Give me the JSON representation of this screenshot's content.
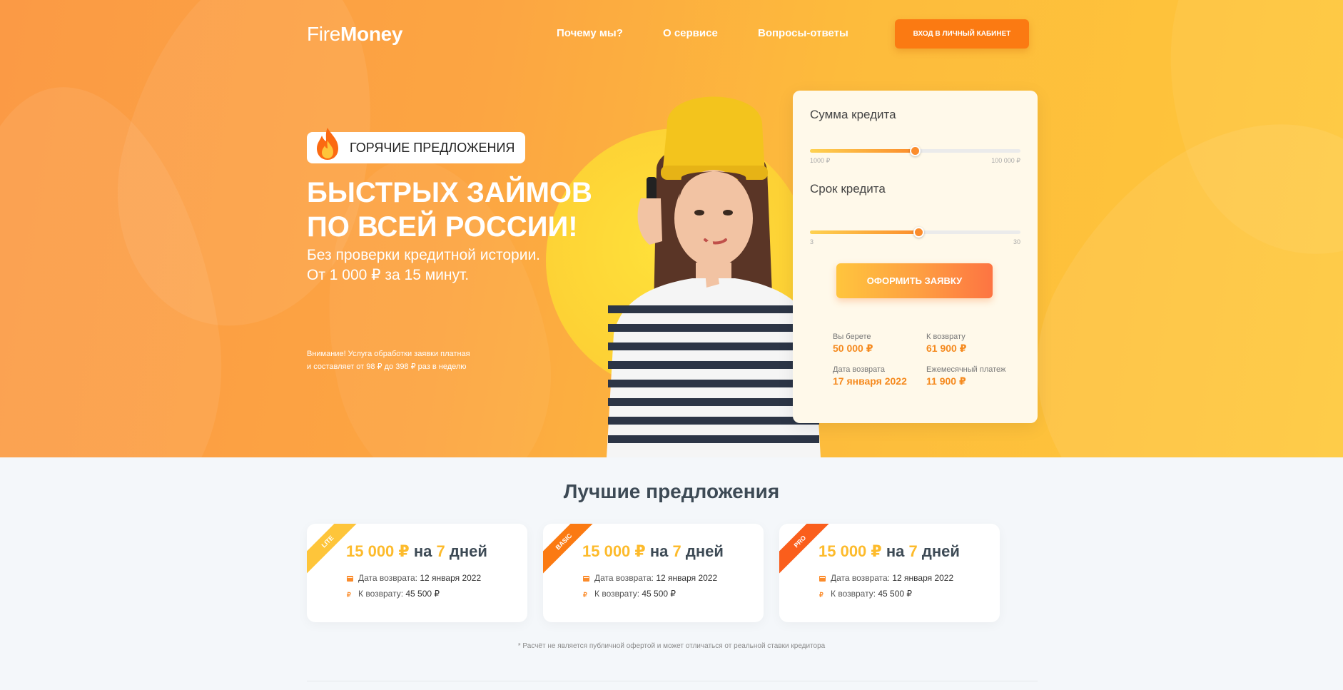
{
  "header": {
    "logo_light": "Fire",
    "logo_bold": "Money",
    "nav": [
      "Почему мы?",
      "О сервисе",
      "Вопросы-ответы"
    ],
    "login_label": "ВХОД В ЛИЧНЫЙ КАБИНЕТ"
  },
  "hero": {
    "badge": "ГОРЯЧИЕ ПРЕДЛОЖЕНИЯ",
    "title_line1": "БЫСТРЫХ ЗАЙМОВ",
    "title_line2": "ПО ВСЕЙ РОССИИ!",
    "sub_line1": "Без проверки кредитной истории.",
    "sub_line2": "От 1 000 ₽ за 15 минут.",
    "note_line1": "Внимание! Услуга обработки заявки платная",
    "note_line2": "и составляет от 98 ₽ до 398 ₽ раз в неделю"
  },
  "calculator": {
    "amount_label": "Сумма кредита",
    "amount_min": "1000 ₽",
    "amount_max": "100 000 ₽",
    "amount_fill_fraction": 0.5,
    "term_label": "Срок кредита",
    "term_min": "3",
    "term_max": "30",
    "term_fill_fraction": 0.52,
    "submit_label": "ОФОРМИТЬ ЗАЯВКУ",
    "take_label": "Вы берете",
    "take_value": "50 000 ₽",
    "return_label": "К возврату",
    "return_value": "61 900 ₽",
    "date_label": "Дата возврата",
    "date_value": "17 января 2022",
    "monthly_label": "Ежемесячный платеж",
    "monthly_value": "11 900 ₽"
  },
  "offers": {
    "title": "Лучшие предложения",
    "cards": [
      {
        "ribbon": "LITE",
        "amount": "15 000 ₽",
        "mid": "на",
        "days": "7",
        "days_word": "дней",
        "date_label": "Дата возврата:",
        "date_value": "12 января 2022",
        "return_label": "К возврату:",
        "return_value": "45 500 ₽"
      },
      {
        "ribbon": "BASIC",
        "amount": "15 000 ₽",
        "mid": "на",
        "days": "7",
        "days_word": "дней",
        "date_label": "Дата возврата:",
        "date_value": "12 января 2022",
        "return_label": "К возврату:",
        "return_value": "45 500 ₽"
      },
      {
        "ribbon": "PRO",
        "amount": "15 000 ₽",
        "mid": "на",
        "days": "7",
        "days_word": "дней",
        "date_label": "Дата возврата:",
        "date_value": "12 января 2022",
        "return_label": "К возврату:",
        "return_value": "45 500 ₽"
      }
    ],
    "disclaimer": "* Расчёт не является публичной офертой и может отличаться от реальной ставки кредитора"
  },
  "colors": {
    "accent": "#fb7a12",
    "highlight": "#fdbb2c",
    "value_orange": "#f58a1f"
  },
  "icons": {
    "badge": "fire-icon",
    "date_row": "calendar-icon",
    "return_row": "ruble-icon"
  }
}
